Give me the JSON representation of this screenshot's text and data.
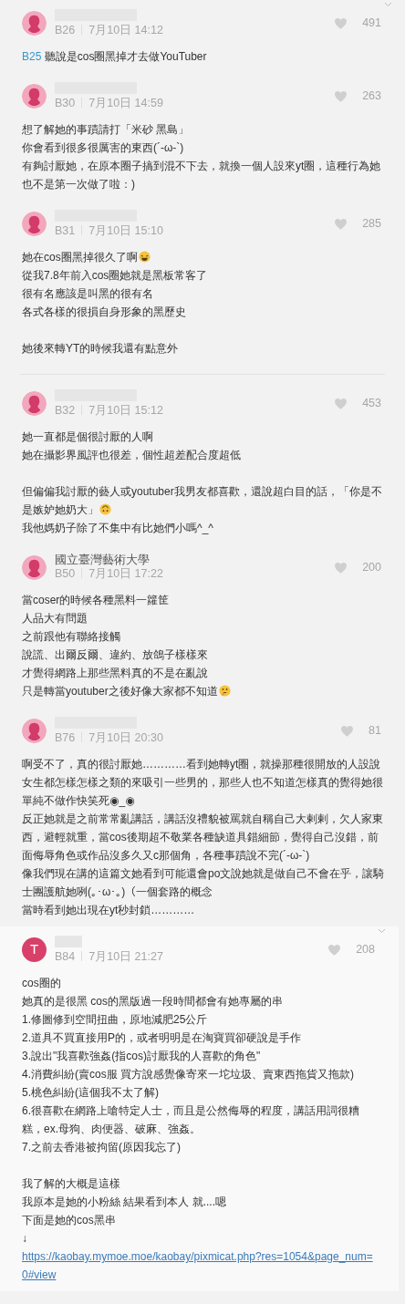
{
  "comments": [
    {
      "floor": "B26",
      "author_redacted": true,
      "avatar": {
        "kind": "silhouette"
      },
      "date": "7月10日 14:12",
      "likes": "491",
      "chevron": true,
      "highlighted": false,
      "divider_after": false,
      "paragraphs": [
        [
          {
            "kind": "text",
            "mention": "B25",
            "text": "聽說是cos圈黑掉才去做YouTuber"
          }
        ]
      ]
    },
    {
      "floor": "B30",
      "author_redacted": true,
      "avatar": {
        "kind": "silhouette"
      },
      "date": "7月10日 14:59",
      "likes": "263",
      "chevron": false,
      "highlighted": false,
      "divider_after": false,
      "paragraphs": [
        [
          {
            "kind": "text",
            "text": "想了解她的事蹟請打「米砂 黑島」"
          },
          {
            "kind": "text",
            "text": "你會看到很多很厲害的東西(´-ω-`)"
          },
          {
            "kind": "text",
            "text": "有夠討厭她，在原本圈子搞到混不下去，就換一個人設來yt圈，這種行為她也不是第一次做了啦：)"
          }
        ]
      ]
    },
    {
      "floor": "B31",
      "author_redacted": true,
      "avatar": {
        "kind": "silhouette"
      },
      "date": "7月10日 15:10",
      "likes": "285",
      "chevron": false,
      "highlighted": false,
      "divider_after": true,
      "paragraphs": [
        [
          {
            "kind": "text",
            "text": "她在cos圈黑掉很久了啊",
            "emoji": {
              "kind": "laughing"
            }
          },
          {
            "kind": "text",
            "text": "從我7.8年前入cos圈她就是黑板常客了"
          },
          {
            "kind": "text",
            "text": "很有名應該是叫黑的很有名"
          },
          {
            "kind": "text",
            "text": "各式各樣的很損自身形象的黑歷史"
          }
        ],
        [
          {
            "kind": "text",
            "text": "她後來轉YT的時候我還有點意外"
          }
        ]
      ]
    },
    {
      "floor": "B32",
      "author_redacted": true,
      "avatar": {
        "kind": "silhouette"
      },
      "date": "7月10日 15:12",
      "likes": "453",
      "chevron": false,
      "highlighted": false,
      "divider_after": false,
      "paragraphs": [
        [
          {
            "kind": "text",
            "text": "她一直都是個很討厭的人啊"
          },
          {
            "kind": "text",
            "text": "她在攝影界風評也很差，個性超差配合度超低"
          }
        ],
        [
          {
            "kind": "text",
            "text": "但偏偏我討厭的藝人或youtuber我男友都喜歡，還說超白目的話，「你是不"
          },
          {
            "kind": "text",
            "text": "是嫉妒她奶大」",
            "emoji": {
              "kind": "upside_down"
            }
          },
          {
            "kind": "text",
            "text": "我他媽奶子除了不集中有比她們小嗎^_^"
          }
        ]
      ]
    },
    {
      "floor": "B50",
      "author_redacted": false,
      "author": "國立臺灣藝術大學",
      "avatar": {
        "kind": "silhouette"
      },
      "date": "7月10日 17:22",
      "likes": "200",
      "chevron": false,
      "highlighted": false,
      "divider_after": false,
      "paragraphs": [
        [
          {
            "kind": "text",
            "text": "當coser的時候各種黑料一籮筐"
          },
          {
            "kind": "text",
            "text": "人品大有問題"
          },
          {
            "kind": "text",
            "text": "之前跟他有聯絡接觸"
          },
          {
            "kind": "text",
            "text": "說謊、出爾反爾、違約、放鴿子樣樣來"
          },
          {
            "kind": "text",
            "text": "才覺得網路上那些黑料真的不是在亂說"
          },
          {
            "kind": "text",
            "text": "只是轉當youtuber之後好像大家都不知道",
            "emoji": {
              "kind": "thinking"
            }
          }
        ]
      ]
    },
    {
      "floor": "B76",
      "author_redacted": true,
      "avatar": {
        "kind": "silhouette"
      },
      "date": "7月10日 20:30",
      "likes": "81",
      "chevron": false,
      "highlighted": false,
      "divider_after": false,
      "paragraphs": [
        [
          {
            "kind": "text",
            "text": "啊受不了，真的很討厭她…………看到她轉yt圈，就操那種很開放的人設說女生都怎樣怎樣之類的來吸引一些男的，那些人也不知道怎樣真的覺得她很單純不做作快笑死◉_◉"
          },
          {
            "kind": "text",
            "text": "反正她就是之前常常亂講話，講話沒禮貌被罵就自稱自己大剌剌，欠人家東西，避輕就重，當cos後期超不敬業各種缺道具錯細節，覺得自己沒錯，前面侮辱角色或作品沒多久又c那個角，各種事蹟說不完(´-ω-`)"
          },
          {
            "kind": "text",
            "text": "像我們現在講的這篇文她看到可能還會po文說她就是做自己不會在乎，讓騎士團護航她咧(｡･ω･｡)（一個套路的概念"
          },
          {
            "kind": "text",
            "text": "當時看到她出現在yt秒封鎖…………"
          }
        ]
      ]
    },
    {
      "floor": "B84",
      "author_redacted": true,
      "avatar": {
        "kind": "letter",
        "letter": "T"
      },
      "date": "7月10日 21:27",
      "likes": "208",
      "chevron": true,
      "highlighted": true,
      "divider_after": false,
      "paragraphs": [
        [
          {
            "kind": "text",
            "text": "cos圈的"
          },
          {
            "kind": "text",
            "text": "她真的是很黑 cos的黑版過一段時間都會有她專屬的串"
          },
          {
            "kind": "text",
            "text": "1.修圖修到空間扭曲，原地減肥25公斤"
          },
          {
            "kind": "text",
            "text": "2.道具不買直接用P的，或者明明是在淘寶買卻硬說是手作"
          },
          {
            "kind": "text",
            "text": "3.說出\"我喜歡強姦(指cos)討厭我的人喜歡的角色\""
          },
          {
            "kind": "text",
            "text": "4.消費糾紛(賣cos服 買方說感覺像寄來一坨垃圾、賣東西拖貨又拖款)"
          },
          {
            "kind": "text",
            "text": "5.桃色糾紛(這個我不太了解)"
          },
          {
            "kind": "text",
            "text": "6.很喜歡在網路上嗆特定人士，而且是公然侮辱的程度，講話用詞很糟糕，ex.母狗、肉便器、破麻、強姦。"
          },
          {
            "kind": "text",
            "text": "7.之前去香港被拘留(原因我忘了)"
          }
        ],
        [
          {
            "kind": "text",
            "text": "我了解的大概是這樣"
          },
          {
            "kind": "text",
            "text": "我原本是她的小粉絲 結果看到本人 就....嗯"
          },
          {
            "kind": "text",
            "text": "下面是她的cos黑串"
          },
          {
            "kind": "text",
            "text": "↓"
          },
          {
            "kind": "link",
            "text": "https://kaobay.mymoe.moe/kaobay/pixmicat.php?res=1054&page_num=0#view"
          }
        ]
      ]
    }
  ]
}
